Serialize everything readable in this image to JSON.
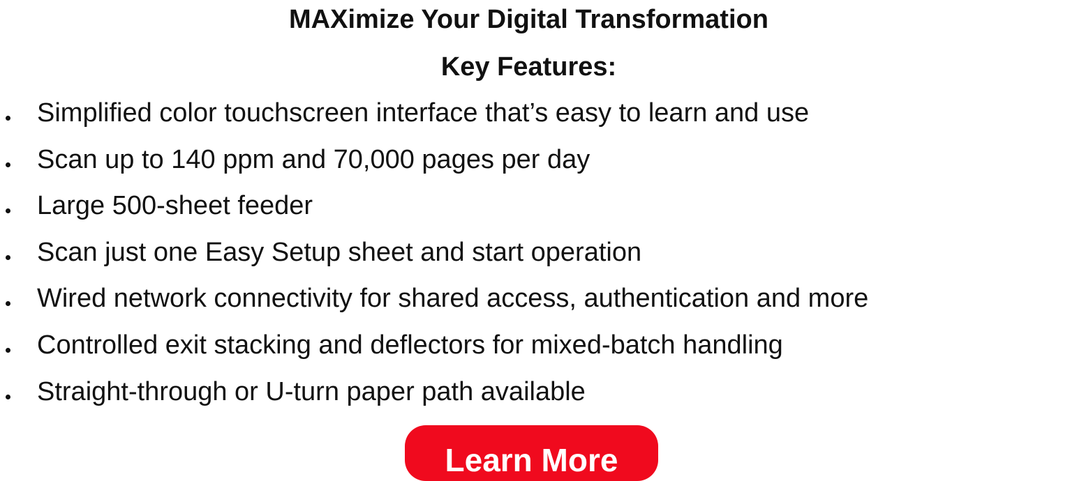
{
  "header": {
    "title": "MAXimize Your Digital Transformation",
    "subtitle": "Key Features:"
  },
  "features": [
    "Simplified color touchscreen interface that’s easy to learn and use",
    "Scan up to 140 ppm and 70,000 pages per day",
    "Large 500-sheet feeder",
    "Scan just one Easy Setup sheet and start operation",
    "Wired network connectivity for shared access, authentication and more",
    "Controlled exit stacking and deflectors for mixed-batch handling",
    "Straight-through or U-turn paper path available"
  ],
  "cta": {
    "label": "Learn More",
    "color": "#f00a1e"
  }
}
